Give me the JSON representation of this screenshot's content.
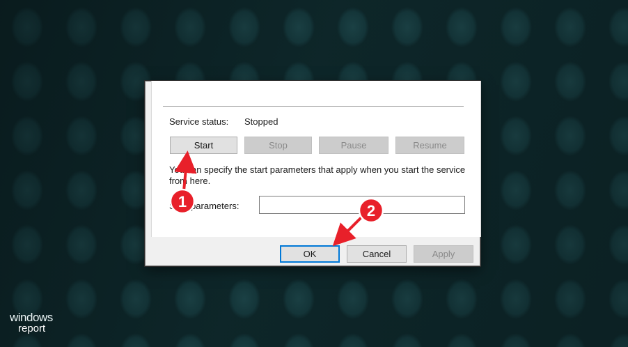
{
  "service": {
    "status_label": "Service status:",
    "status_value": "Stopped",
    "buttons": [
      {
        "label": "Start",
        "enabled": true
      },
      {
        "label": "Stop",
        "enabled": false
      },
      {
        "label": "Pause",
        "enabled": false
      },
      {
        "label": "Resume",
        "enabled": false
      }
    ],
    "hint": "You can specify the start parameters that apply when you start the service from here.",
    "param_label": "Start parameters:",
    "param_value": ""
  },
  "dialog_buttons": {
    "ok": "OK",
    "cancel": "Cancel",
    "apply": "Apply"
  },
  "annotations": {
    "step1": "1",
    "step2": "2",
    "marker_color": "#e8202a"
  },
  "logo": {
    "line1": "windows",
    "line2": "report"
  }
}
